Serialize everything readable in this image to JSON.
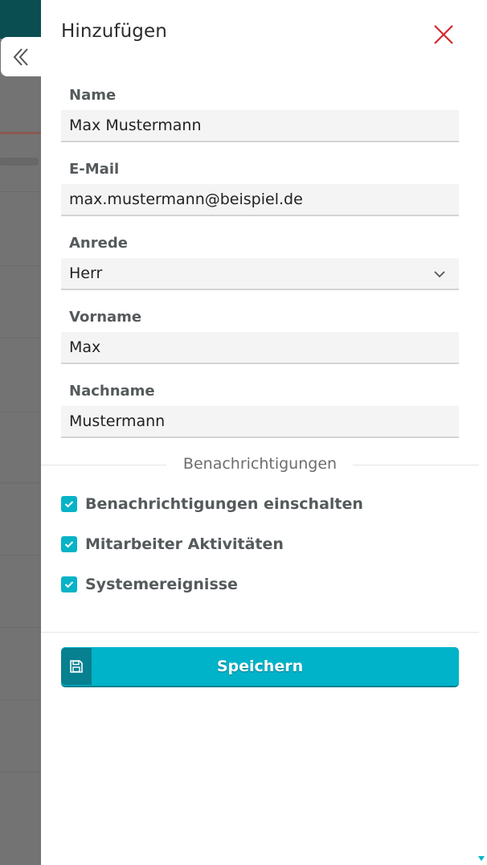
{
  "drawer": {
    "title": "Hinzufügen",
    "close_icon": "close-icon"
  },
  "form": {
    "name": {
      "label": "Name",
      "value": "Max Mustermann"
    },
    "email": {
      "label": "E-Mail",
      "value": "max.mustermann@beispiel.de"
    },
    "salutation": {
      "label": "Anrede",
      "value": "Herr"
    },
    "first_name": {
      "label": "Vorname",
      "value": "Max"
    },
    "last_name": {
      "label": "Nachname",
      "value": "Mustermann"
    }
  },
  "notifications": {
    "title": "Benachrichtigungen",
    "items": [
      {
        "label": "Benachrichtigungen einschalten",
        "checked": true
      },
      {
        "label": "Mitarbeiter Aktivitäten",
        "checked": true
      },
      {
        "label": "Systemereignisse",
        "checked": true
      }
    ]
  },
  "save_button": {
    "label": "Speichern",
    "icon": "save-icon"
  },
  "colors": {
    "accent": "#00b3c9",
    "accent_dark": "#07808f",
    "close_red": "#d8262c",
    "header_teal": "#0b4e51"
  }
}
